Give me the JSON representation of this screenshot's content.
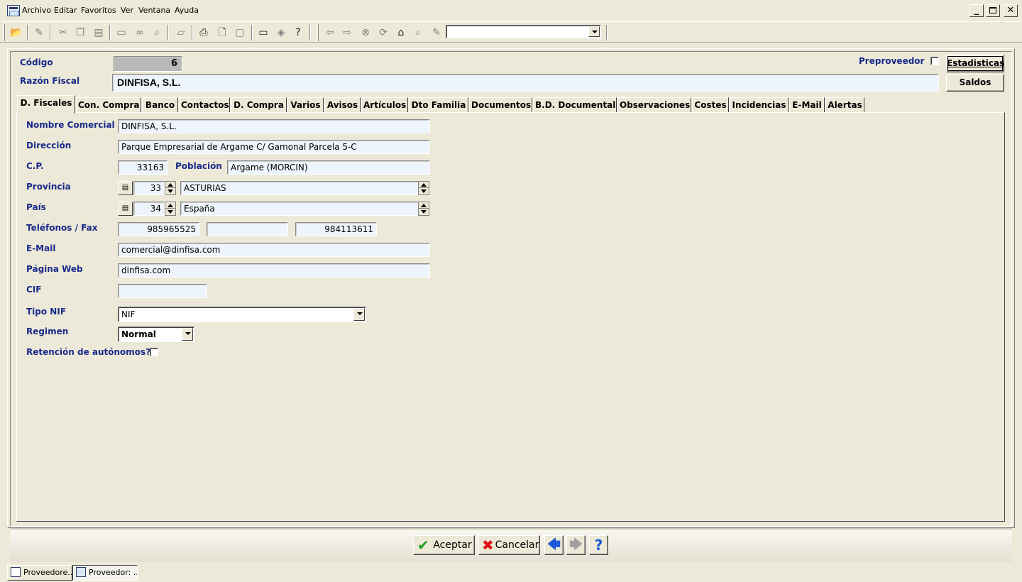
{
  "menu": {
    "items": [
      "Archivo",
      "Editar",
      "Favoritos",
      "Ver",
      "Ventana",
      "Ayuda"
    ]
  },
  "window_controls": {
    "minimize": "_",
    "restore": "🗗",
    "close": "✕"
  },
  "toolbar": {
    "icons": [
      "open-folder-icon",
      "edit-icon",
      "cut-icon",
      "copy-icon",
      "paste-icon",
      "window-icon",
      "binoculars-icon",
      "search-icon",
      "folder-icon",
      "print-icon",
      "print-preview-icon",
      "page-icon",
      "screen-icon",
      "eraser-icon",
      "help-icon",
      "back-arrow-icon",
      "forward-arrow-icon",
      "stop-icon",
      "refresh-icon",
      "home-icon",
      "search-web-icon",
      "favorites-icon"
    ],
    "combo_value": ""
  },
  "header": {
    "codigo_label": "Código",
    "codigo_value": "6",
    "razon_label": "Razón Fiscal",
    "razon_value": "DINFISA, S.L.",
    "preproveedor_label": "Preproveedor",
    "estadisticas_label": "Estadisticas",
    "saldos_label": "Saldos"
  },
  "tabs": [
    "D. Fiscales",
    "Con. Compra",
    "Banco",
    "Contactos",
    "D. Compra",
    "Varios",
    "Avisos",
    "Artículos",
    "Dto Familia",
    "Documentos",
    "B.D. Documental",
    "Observaciones",
    "Costes",
    "Incidencias",
    "E-Mail",
    "Alertas"
  ],
  "fiscales": {
    "nombre_comercial_label": "Nombre Comercial",
    "nombre_comercial": "DINFISA, S.L.",
    "direccion_label": "Dirección",
    "direccion": "Parque Empresarial de Argame C/ Gamonal Parcela 5-C",
    "cp_label": "C.P.",
    "cp": "33163",
    "poblacion_label": "Población",
    "poblacion": "Argame (MORCIN)",
    "provincia_label": "Provincia",
    "provincia_code": "33",
    "provincia": "ASTURIAS",
    "pais_label": "País",
    "pais_code": "34",
    "pais": "España",
    "telefonos_label": "Teléfonos / Fax",
    "telefono1": "985965525",
    "telefono2": "",
    "fax": "984113611",
    "email_label": "E-Mail",
    "email": "comercial@dinfisa.com",
    "web_label": "Página Web",
    "web": "dinfisa.com",
    "cif_label": "CIF",
    "cif": "",
    "tipo_nif_label": "Tipo NIF",
    "tipo_nif": "NIF",
    "regimen_label": "Regimen",
    "regimen": "Normal",
    "retencion_label": "Retención de autónomos?"
  },
  "footer": {
    "aceptar": "Aceptar",
    "cancelar": "Cancelar",
    "help": "?"
  },
  "taskbar": [
    "Proveedore...",
    "Proveedor: ..."
  ]
}
